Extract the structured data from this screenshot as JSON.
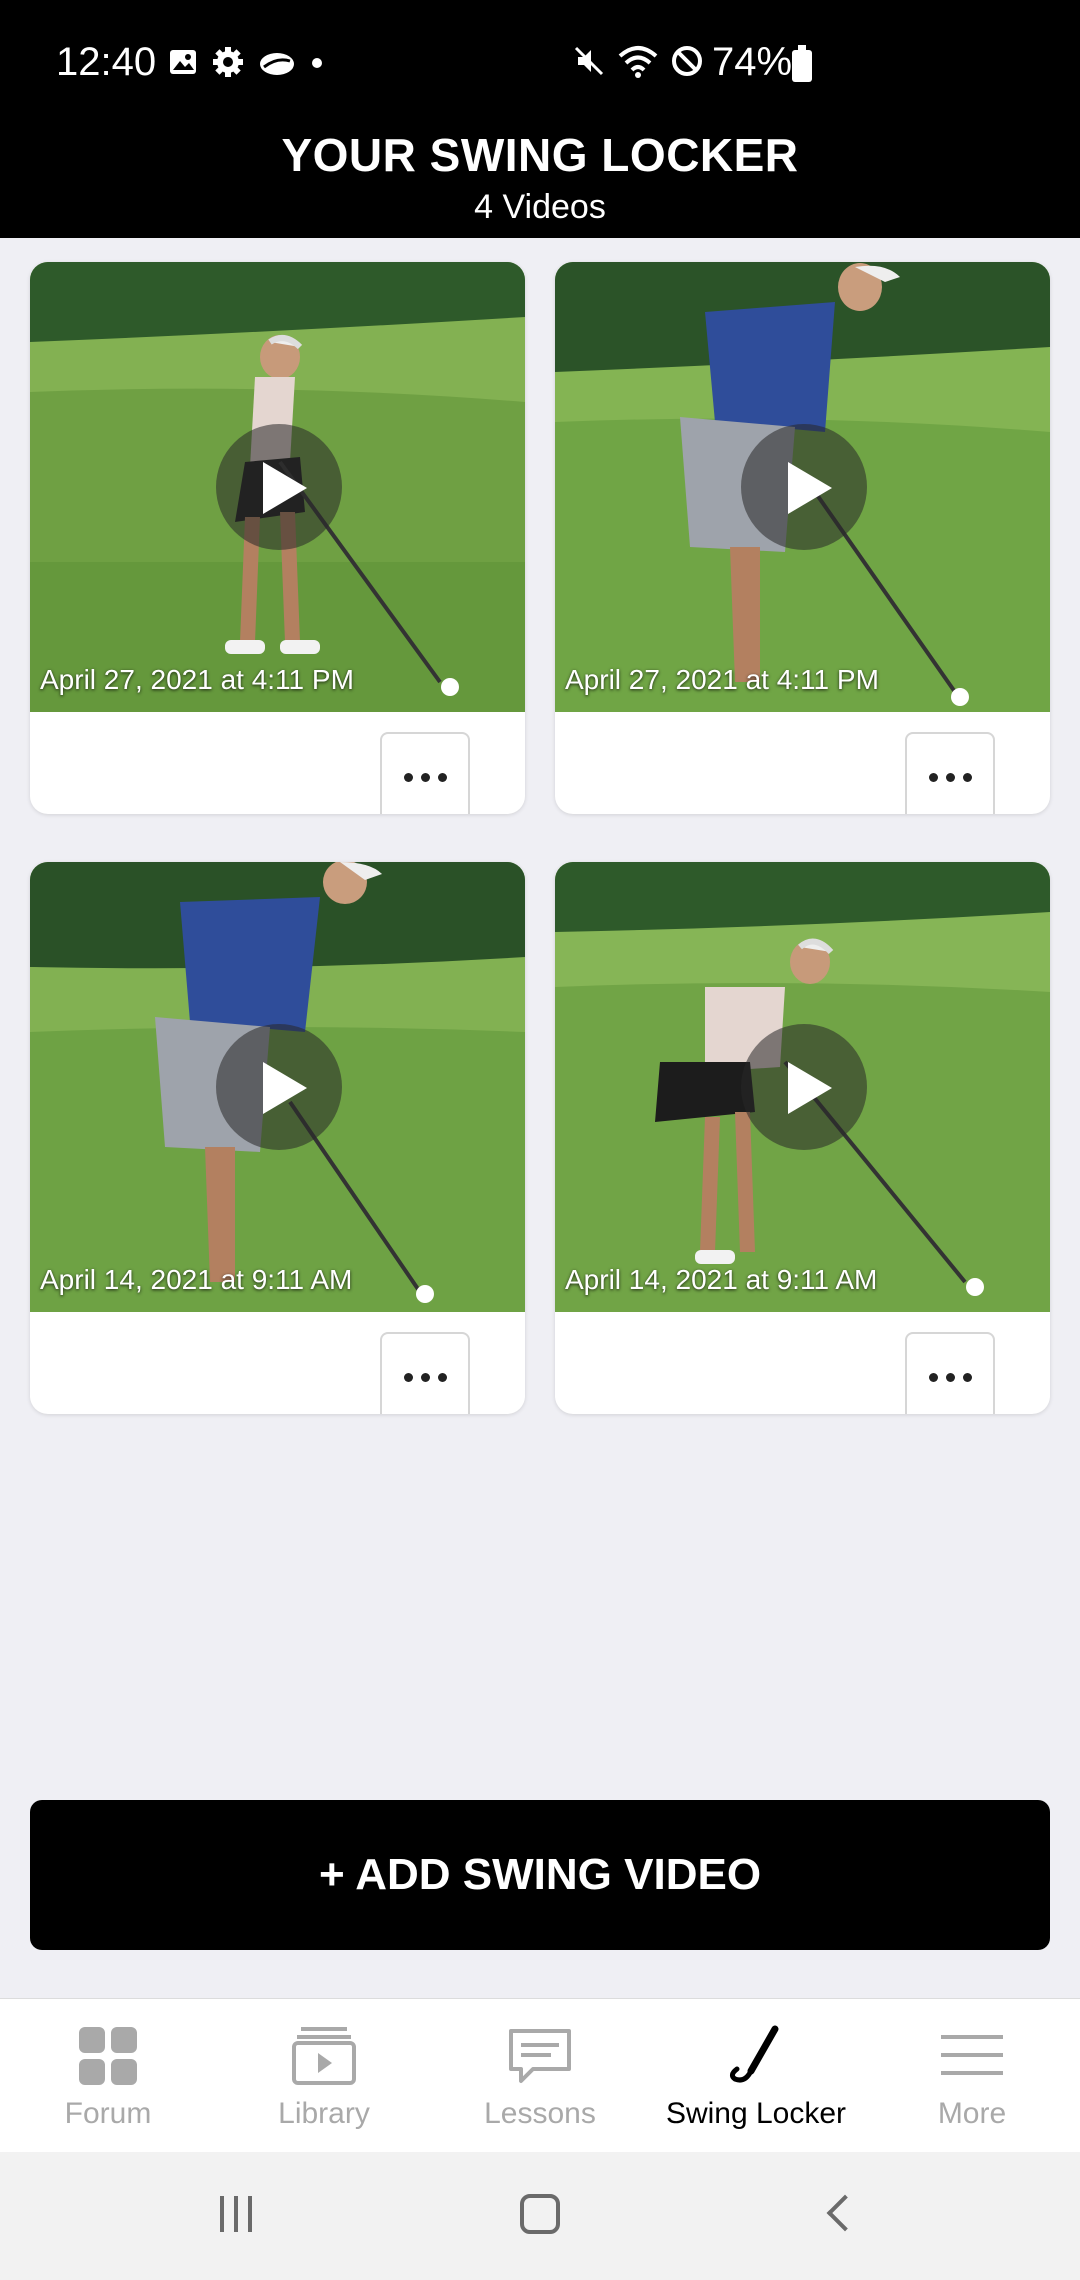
{
  "status_bar": {
    "time": "12:40",
    "battery": "74%",
    "left_icons": [
      "image-icon",
      "gear-icon",
      "cloud-icon",
      "dot-icon"
    ],
    "right_icons": [
      "mute-icon",
      "wifi-icon",
      "block-icon",
      "battery-icon"
    ]
  },
  "header": {
    "title": "YOUR SWING LOCKER",
    "subtitle": "4 Videos"
  },
  "videos": [
    {
      "date": "April 27, 2021 at 4:11 PM",
      "golfer": "female"
    },
    {
      "date": "April 27, 2021 at 4:11 PM",
      "golfer": "male"
    },
    {
      "date": "April 14, 2021 at 9:11 AM",
      "golfer": "male"
    },
    {
      "date": "April 14, 2021 at 9:11 AM",
      "golfer": "female"
    }
  ],
  "add_button": {
    "label": "+ ADD SWING VIDEO"
  },
  "bottom_nav": {
    "items": [
      {
        "label": "Forum",
        "icon": "grid-icon",
        "active": false
      },
      {
        "label": "Library",
        "icon": "library-icon",
        "active": false
      },
      {
        "label": "Lessons",
        "icon": "chat-icon",
        "active": false
      },
      {
        "label": "Swing Locker",
        "icon": "golf-club-icon",
        "active": true
      },
      {
        "label": "More",
        "icon": "menu-icon",
        "active": false
      }
    ]
  },
  "colors": {
    "header_bg": "#000000",
    "page_bg": "#efeff4",
    "inactive_nav": "#a9a9a9",
    "active_nav": "#000000",
    "grass": "#6fa043"
  }
}
